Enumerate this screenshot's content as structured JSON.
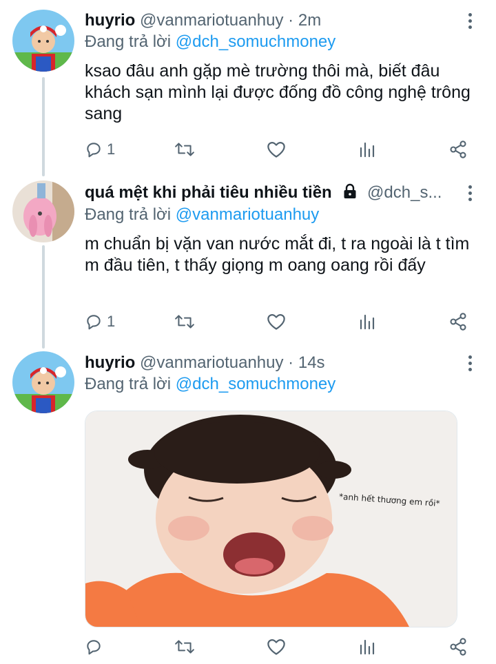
{
  "tweets": [
    {
      "name": "huyrio",
      "handle": "@vanmariotuanhuy",
      "sep": "·",
      "time": "2m",
      "replying_prefix": "Đang trả lời",
      "replying_to": "@dch_somuchmoney",
      "text": "ksao đâu anh gặp mè trường thôi mà, biết đâu khách sạn mình lại được đống đồ công nghệ trông sang",
      "reply_count": "1"
    },
    {
      "name": "quá mệt khi phải tiêu nhiều tiền",
      "handle": "@dch_s...",
      "replying_prefix": "Đang trả lời",
      "replying_to": "@vanmariotuanhuy",
      "text": "m chuẩn bị vặn van nước mắt đi, t ra ngoài là t tìm m đầu tiên, t thấy giọng m oang oang rồi đấy",
      "reply_count": "1"
    },
    {
      "name": "huyrio",
      "handle": "@vanmariotuanhuy",
      "sep": "·",
      "time": "14s",
      "replying_prefix": "Đang trả lời",
      "replying_to": "@dch_somuchmoney",
      "image_caption": "*anh hết thương em rồi*",
      "reply_count": ""
    }
  ],
  "icons": [
    "reply-icon",
    "retweet-icon",
    "like-icon",
    "analytics-icon",
    "share-icon",
    "more-icon",
    "lock-icon"
  ],
  "colors": {
    "link": "#1d9bf0",
    "muted": "#536471",
    "text": "#0f1419",
    "thread": "#cfd9de"
  }
}
